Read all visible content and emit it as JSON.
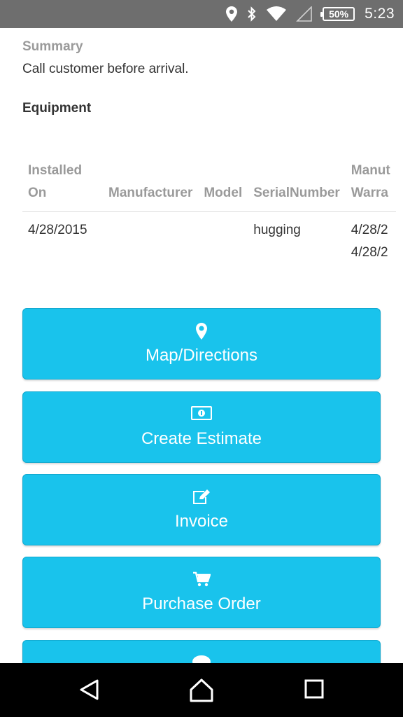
{
  "status_bar": {
    "battery_percent": "50%",
    "time": "5:23",
    "icons": [
      "location-icon",
      "bluetooth-icon",
      "wifi-icon",
      "signal-icon",
      "battery-icon"
    ]
  },
  "summary": {
    "label": "Summary",
    "text": "Call customer before arrival."
  },
  "equipment": {
    "label": "Equipment",
    "columns": [
      {
        "line1": "Installed",
        "line2": "On"
      },
      {
        "line1": "",
        "line2": "Manufacturer"
      },
      {
        "line1": "",
        "line2": "Model"
      },
      {
        "line1": "",
        "line2": "SerialNumber"
      },
      {
        "line1": "Manut",
        "line2": "Warra"
      }
    ],
    "rows": [
      {
        "installed_on": "4/28/2015",
        "manufacturer": "",
        "model": "",
        "serial_number": "hugging",
        "warranty_1": "4/28/2",
        "warranty_2": "4/28/2"
      }
    ]
  },
  "actions": [
    {
      "label": "Map/Directions",
      "icon": "map-marker-icon"
    },
    {
      "label": "Create Estimate",
      "icon": "money-icon"
    },
    {
      "label": "Invoice",
      "icon": "edit-icon"
    },
    {
      "label": "Purchase Order",
      "icon": "shopping-cart-icon"
    },
    {
      "label": "",
      "icon": "comment-icon"
    }
  ],
  "nav_bar": {
    "icons": [
      "back-icon",
      "home-icon",
      "recents-icon"
    ]
  },
  "colors": {
    "status_bar": "#6e6e6e",
    "button": "#19c3ec",
    "nav_bar": "#000000"
  }
}
